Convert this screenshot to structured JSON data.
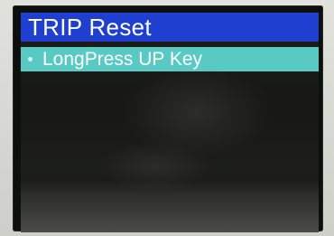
{
  "screen": {
    "title": "TRIP Reset",
    "menu_items": [
      {
        "label": "LongPress UP Key",
        "selected": true
      }
    ]
  },
  "colors": {
    "title_bar": "#1f3fd1",
    "selected_row": "#59c9c4",
    "text": "#ffffff",
    "background": "#171815"
  }
}
